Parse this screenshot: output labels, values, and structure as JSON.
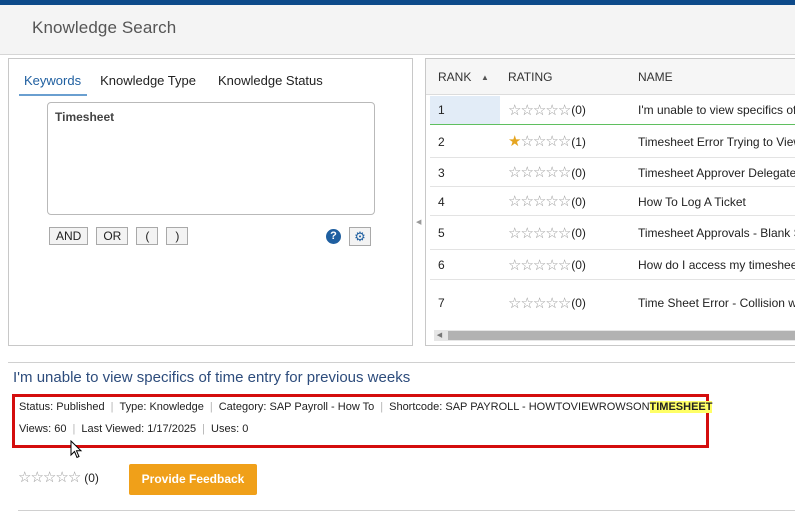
{
  "header": {
    "title": "Knowledge Search"
  },
  "search": {
    "tabs": [
      "Keywords",
      "Knowledge Type",
      "Knowledge Status"
    ],
    "keyword_value": "Timesheet",
    "operators": [
      "AND",
      "OR",
      "(",
      ")"
    ],
    "help_glyph": "?",
    "settings_glyph": "⚙"
  },
  "results": {
    "columns": {
      "rank": "RANK",
      "rating": "RATING",
      "name": "NAME"
    },
    "rows": [
      {
        "rank": "1",
        "count": "(0)",
        "stars_filled": 0,
        "name": "I'm unable to view specifics of"
      },
      {
        "rank": "2",
        "count": "(1)",
        "stars_filled": 1,
        "name": "Timesheet Error Trying to View"
      },
      {
        "rank": "3",
        "count": "(0)",
        "stars_filled": 0,
        "name": "Timesheet Approver Delegate"
      },
      {
        "rank": "4",
        "count": "(0)",
        "stars_filled": 0,
        "name": "How To Log A Ticket"
      },
      {
        "rank": "5",
        "count": "(0)",
        "stars_filled": 0,
        "name": "Timesheet Approvals - Blank S"
      },
      {
        "rank": "6",
        "count": "(0)",
        "stars_filled": 0,
        "name": "How do I access my timesheet"
      },
      {
        "rank": "7",
        "count": "(0)",
        "stars_filled": 0,
        "name": "Time Sheet Error - Collision wi"
      }
    ]
  },
  "detail": {
    "title": "I'm unable to view specifics of time entry for previous weeks",
    "status": "Status: Published",
    "type": "Type: Knowledge",
    "category_label": "Category:",
    "category_value": "SAP Payroll - How To",
    "shortcode_label": "Shortcode:",
    "shortcode_value": "SAP PAYROLL - HOWTOVIEWROWSON",
    "shortcode_highlight": "TIMESHEET",
    "views_label": "Views:",
    "views_value": "60",
    "last_viewed_label": "Last Viewed:",
    "last_viewed_value": "1/17/2025",
    "uses_label": "Uses:",
    "uses_value": "0",
    "rating_count": "(0)",
    "feedback_button": "Provide Feedback"
  },
  "colors": {
    "accent": "#1f5fa0",
    "highlight_box": "#d40d0d",
    "feedback_button": "#f0a019",
    "star_filled": "#e5a520"
  }
}
